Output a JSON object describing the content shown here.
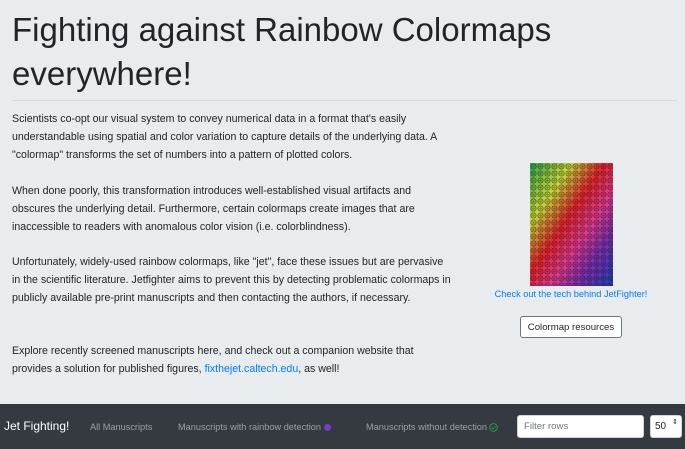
{
  "header": {
    "title": "Fighting against Rainbow Colormaps everywhere!"
  },
  "intro": {
    "paragraph_1": "Scientists co-opt our visual system to convey numerical data in a format that's easily understandable using spatial and color variation to capture details of the underlying data. A \"colormap\" transforms the set of numbers into a pattern of plotted colors.",
    "paragraph_2": "When done poorly, this transformation introduces well-established visual artifacts and obscures the underlying detail. Furthermore, certain colormaps create images that are inaccessible to readers with anomalous color vision (i.e. colorblindness).",
    "paragraph_3": "Unfortunately, widely-used rainbow colormaps, like \"jet\", face these issues but are pervasive in the scientific literature. Jetfighter aims to prevent this by detecting problematic colormaps in publicly available pre-print manuscripts and then contacting the authors, if necessary.",
    "paragraph_4_before": "Explore recently screened manuscripts here, and check out a companion website that provides a solution for published figures, ",
    "paragraph_4_link": "fixthejet.caltech.edu",
    "paragraph_4_after": ", as well!"
  },
  "sidebar": {
    "image_icon": "rainbow-straws-image",
    "tech_link": "Check out the tech behind JetFighter!",
    "resources_button": "Colormap resources"
  },
  "navbar": {
    "brand": "Jet Fighting!",
    "links": [
      "All Manuscripts",
      "Manuscripts with rainbow detection",
      "Manuscripts without detection"
    ],
    "rainbow_icon": "purple-dot-icon",
    "no_detection_icon": "check-circle-icon",
    "filter_placeholder": "Filter rows",
    "rows_per_page": "50",
    "rows_caret": "⇕"
  },
  "colors": {
    "accent": "#007bff",
    "navbar_bg": "#343a40",
    "jumbotron_bg": "#e9ecef",
    "rainbow_dot": "#6f42c1",
    "check_green": "#28a745"
  }
}
